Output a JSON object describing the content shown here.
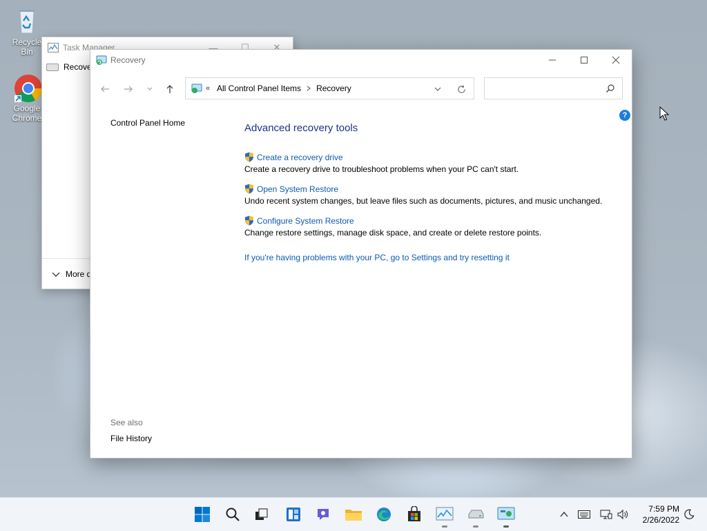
{
  "desktop": {
    "icons": [
      {
        "label": "Recycle Bin",
        "name": "recycle-bin"
      },
      {
        "label": "Google Chrome",
        "name": "google-chrome"
      }
    ]
  },
  "task_manager": {
    "title": "Task Manager",
    "row_label": "Recovery",
    "footer_label": "More details"
  },
  "window": {
    "title": "Recovery",
    "breadcrumb": [
      "All Control Panel Items",
      "Recovery"
    ],
    "breadcrumb_prefix": "«",
    "search_placeholder": "",
    "help_label": "?"
  },
  "left_pane": {
    "home_link": "Control Panel Home",
    "see_also_heading": "See also",
    "see_also_links": [
      "File History"
    ]
  },
  "main": {
    "heading": "Advanced recovery tools",
    "tools": [
      {
        "label": "Create a recovery drive",
        "description": "Create a recovery drive to troubleshoot problems when your PC can't start."
      },
      {
        "label": "Open System Restore",
        "description": "Undo recent system changes, but leave files such as documents, pictures, and music unchanged."
      },
      {
        "label": "Configure System Restore",
        "description": "Change restore settings, manage disk space, and create or delete restore points."
      }
    ],
    "reset_link": "If you're having problems with your PC, go to Settings and try resetting it"
  },
  "taskbar": {
    "apps": [
      "start",
      "search",
      "task-view",
      "widgets",
      "chat",
      "file-explorer",
      "edge",
      "store",
      "task-manager",
      "drive",
      "control-panel"
    ],
    "time": "7:59 PM",
    "date": "2/26/2022"
  },
  "colors": {
    "link": "#0b5ab4",
    "heading": "#1e3287",
    "accent": "#0067c0"
  }
}
